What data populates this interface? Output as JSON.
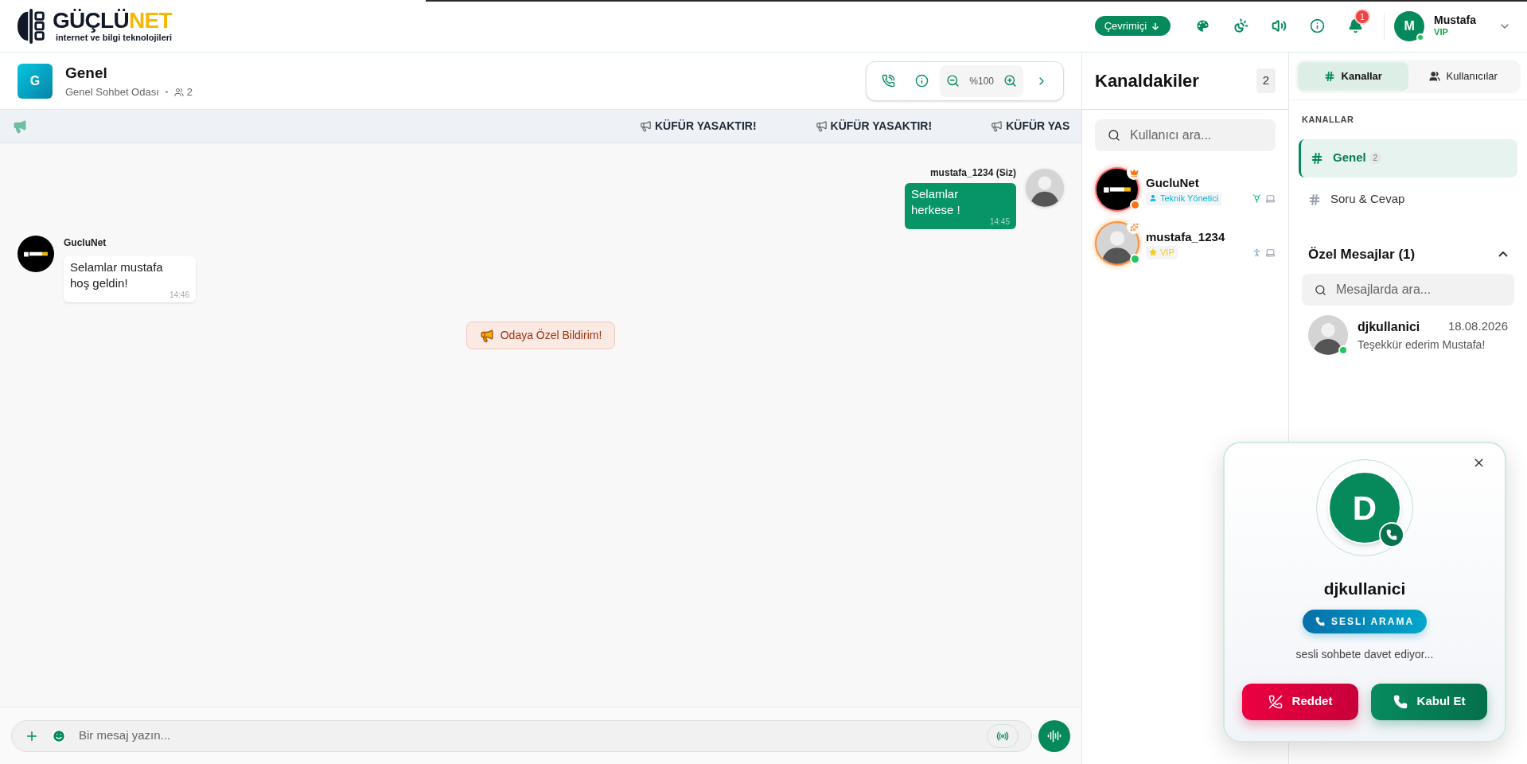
{
  "header": {
    "logo": {
      "name_dark": "GÜÇLÜ",
      "name_accent": "NET",
      "tagline": "internet ve bilgi teknolojileri"
    },
    "status_button": "Çevrimiçi",
    "notification_count": "1",
    "user": {
      "initial": "M",
      "name": "Mustafa",
      "badge": "VIP",
      "online": true
    }
  },
  "room": {
    "initial": "G",
    "title": "Genel",
    "subtitle": "Genel Sohbet Odası",
    "member_count": "2",
    "zoom": "%100"
  },
  "announcements": [
    "KÜFÜR YASAKTIR!",
    "KÜFÜR YASAKTIR!",
    "KÜFÜR YAS"
  ],
  "messages": [
    {
      "kind": "outgoing",
      "author": "mustafa_1234 (Siz)",
      "text": "Selamlar herkese !",
      "time": "14:45"
    },
    {
      "kind": "incoming",
      "author": "GucluNet",
      "text": "Selamlar mustafa hoş geldin!",
      "time": "14:46"
    },
    {
      "kind": "notice",
      "text": "Odaya Özel Bildirim!"
    }
  ],
  "composer": {
    "placeholder": "Bir mesaj yazın..."
  },
  "members_panel": {
    "title": "Kanaldakiler",
    "count": "2",
    "search_placeholder": "Kullanıcı ara...",
    "members": [
      {
        "kind": "admin",
        "name": "GucluNet",
        "role": "Teknik Yönetici",
        "color": "#f97316"
      },
      {
        "kind": "vip",
        "name": "mustafa_1234",
        "role": "VIP",
        "color": "#22c55e"
      }
    ]
  },
  "sidebar": {
    "tabs": [
      {
        "label": "Kanallar",
        "selected": true
      },
      {
        "label": "Kullanıcılar",
        "selected": false
      }
    ],
    "section_title": "KANALLAR",
    "channels": [
      {
        "name": "Genel",
        "count": "2",
        "selected": true
      },
      {
        "name": "Soru & Cevap",
        "selected": false
      }
    ],
    "private_messages": {
      "title": "Özel Mesajlar (1)",
      "expanded": true,
      "search_placeholder": "Mesajlarda ara...",
      "items": [
        {
          "name": "djkullanici",
          "date": "18.08.2026",
          "preview": "Teşekkür ederim Mustafa!",
          "online": true
        }
      ]
    }
  },
  "call": {
    "initial": "D",
    "name": "djkullanici",
    "type": "SESLI ARAMA",
    "text": "sesli sohbete davet ediyor...",
    "reject": "Reddet",
    "accept": "Kabul Et"
  }
}
